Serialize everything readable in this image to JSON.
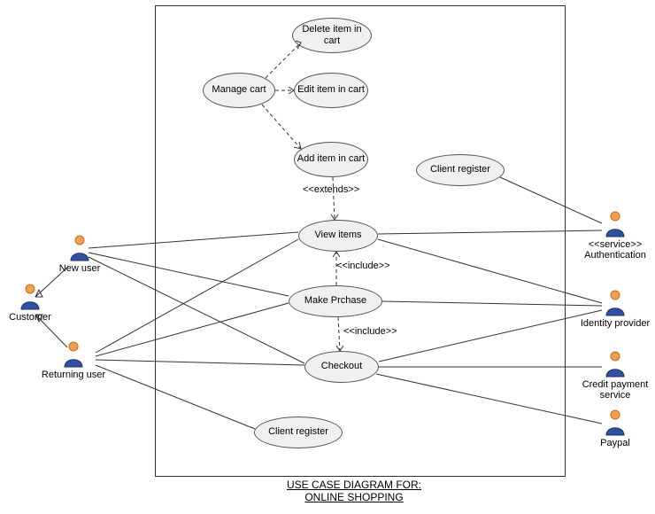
{
  "actors": {
    "customer": "Customer",
    "new_user": "New user",
    "returning_user": "Returning user",
    "authentication_stereo": "<<service>>",
    "authentication": "Authentication",
    "identity_provider": "Identity provider",
    "credit_payment": "Credit payment service",
    "paypal": "Paypal"
  },
  "usecases": {
    "delete_item": "Delete item in cart",
    "manage_cart": "Manage cart",
    "edit_item": "Edit item in cart",
    "add_item": "Add item in cart",
    "client_register_top": "Client register",
    "view_items": "View items",
    "make_purchase": "Make Prchase",
    "checkout": "Checkout",
    "client_register_bottom": "Client register"
  },
  "labels": {
    "extends": "<<extends>>",
    "include1": "<<include>>",
    "include2": "<<include>>"
  },
  "title_line1": "USE CASE DIAGRAM FOR:",
  "title_line2": "ONLINE SHOPPING"
}
